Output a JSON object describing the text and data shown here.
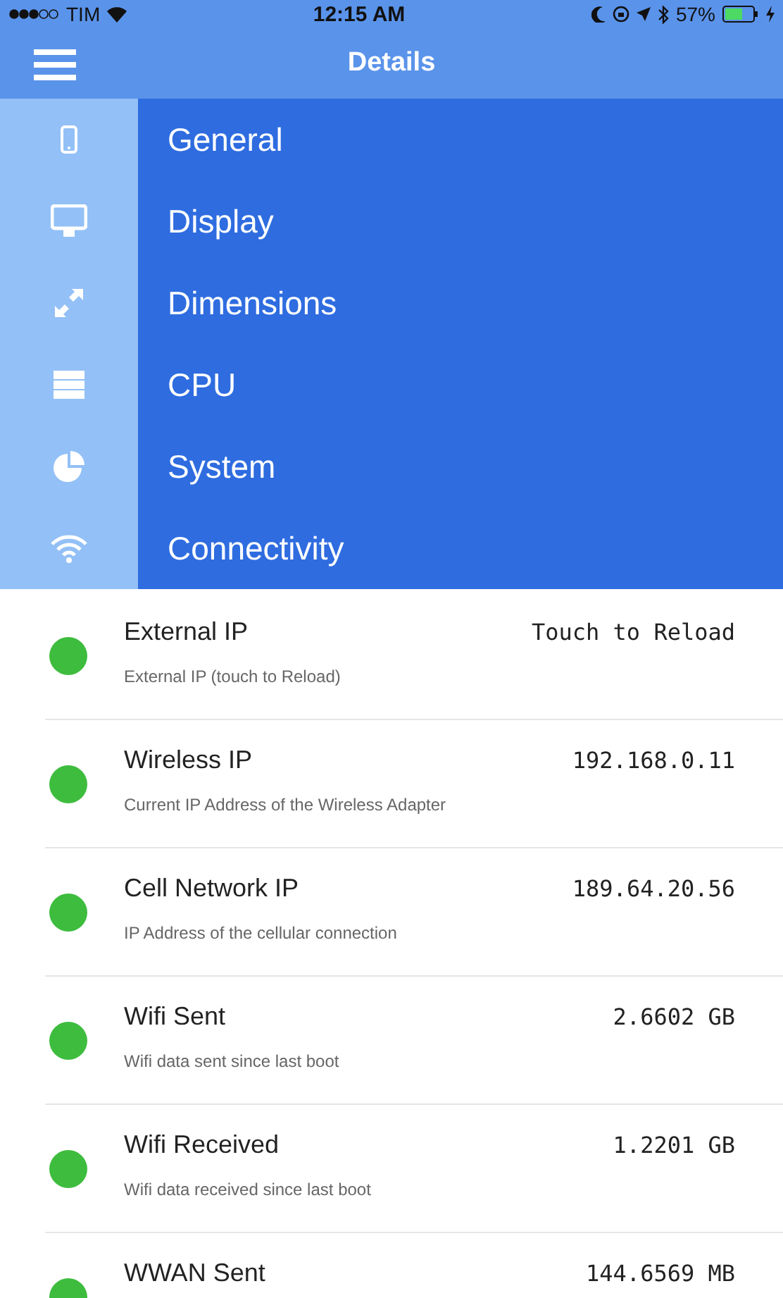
{
  "status_bar": {
    "carrier": "TIM",
    "time": "12:15 AM",
    "battery": "57%"
  },
  "header": {
    "title": "Details"
  },
  "menu": [
    {
      "label": "General"
    },
    {
      "label": "Display"
    },
    {
      "label": "Dimensions"
    },
    {
      "label": "CPU"
    },
    {
      "label": "System"
    },
    {
      "label": "Connectivity"
    }
  ],
  "rows": [
    {
      "title": "External IP",
      "value": "Touch to Reload",
      "description": "External IP (touch to Reload)"
    },
    {
      "title": "Wireless IP",
      "value": "192.168.0.11",
      "description": "Current IP Address of the Wireless Adapter"
    },
    {
      "title": "Cell Network IP",
      "value": "189.64.20.56",
      "description": "IP Address of the cellular connection"
    },
    {
      "title": "Wifi Sent",
      "value": "2.6602 GB",
      "description": "Wifi data sent since last boot"
    },
    {
      "title": "Wifi Received",
      "value": "1.2201 GB",
      "description": "Wifi data received since last boot"
    },
    {
      "title": "WWAN Sent",
      "value": "144.6569 MB"
    }
  ]
}
